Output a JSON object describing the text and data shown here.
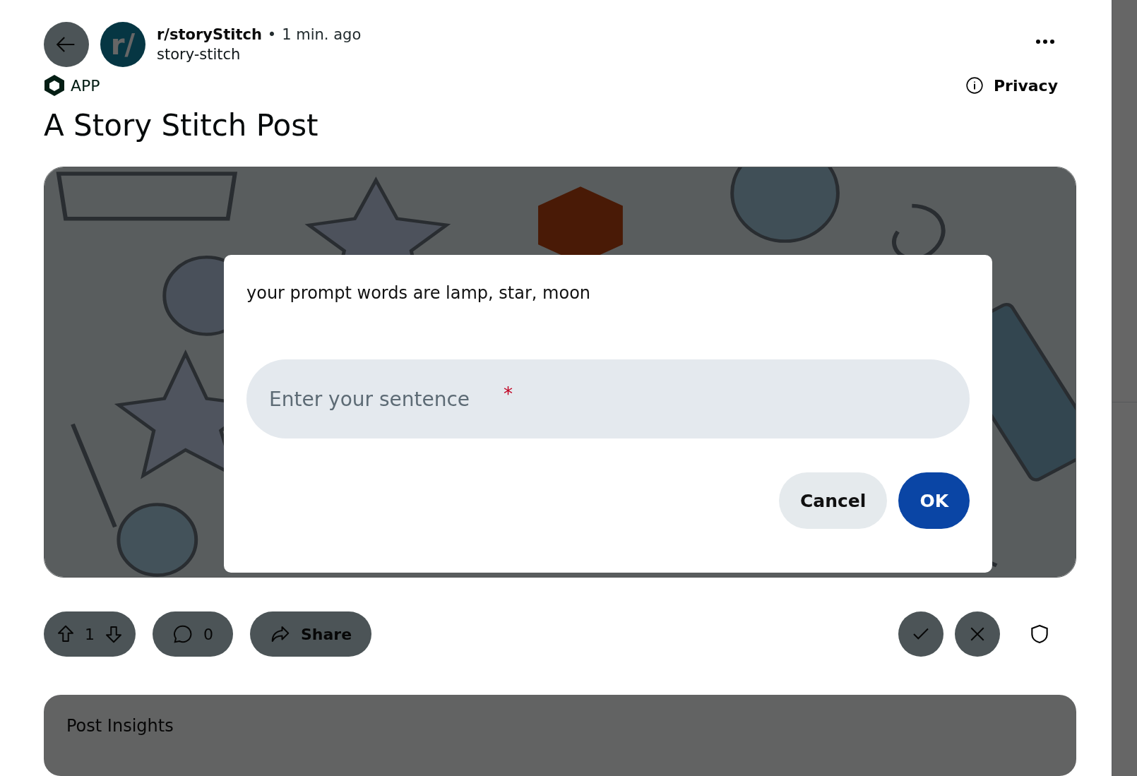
{
  "header": {
    "community": "r/storyStitch",
    "separator": "•",
    "time": "1 min. ago",
    "author": "story-stitch",
    "avatar_text": "r/"
  },
  "app_badge": {
    "label": "APP"
  },
  "privacy": {
    "label": "Privacy"
  },
  "post": {
    "title": "A Story Stitch Post"
  },
  "actions": {
    "votes": "1",
    "comments": "0",
    "share": "Share"
  },
  "insights": {
    "title": "Post Insights"
  },
  "dialog": {
    "message": "your prompt words are lamp, star, moon",
    "field": {
      "placeholder": "Enter your sentence",
      "required_mark": "*"
    },
    "buttons": [
      {
        "label": "Cancel",
        "kind": "secondary"
      },
      {
        "label": "OK",
        "kind": "primary"
      }
    ]
  }
}
